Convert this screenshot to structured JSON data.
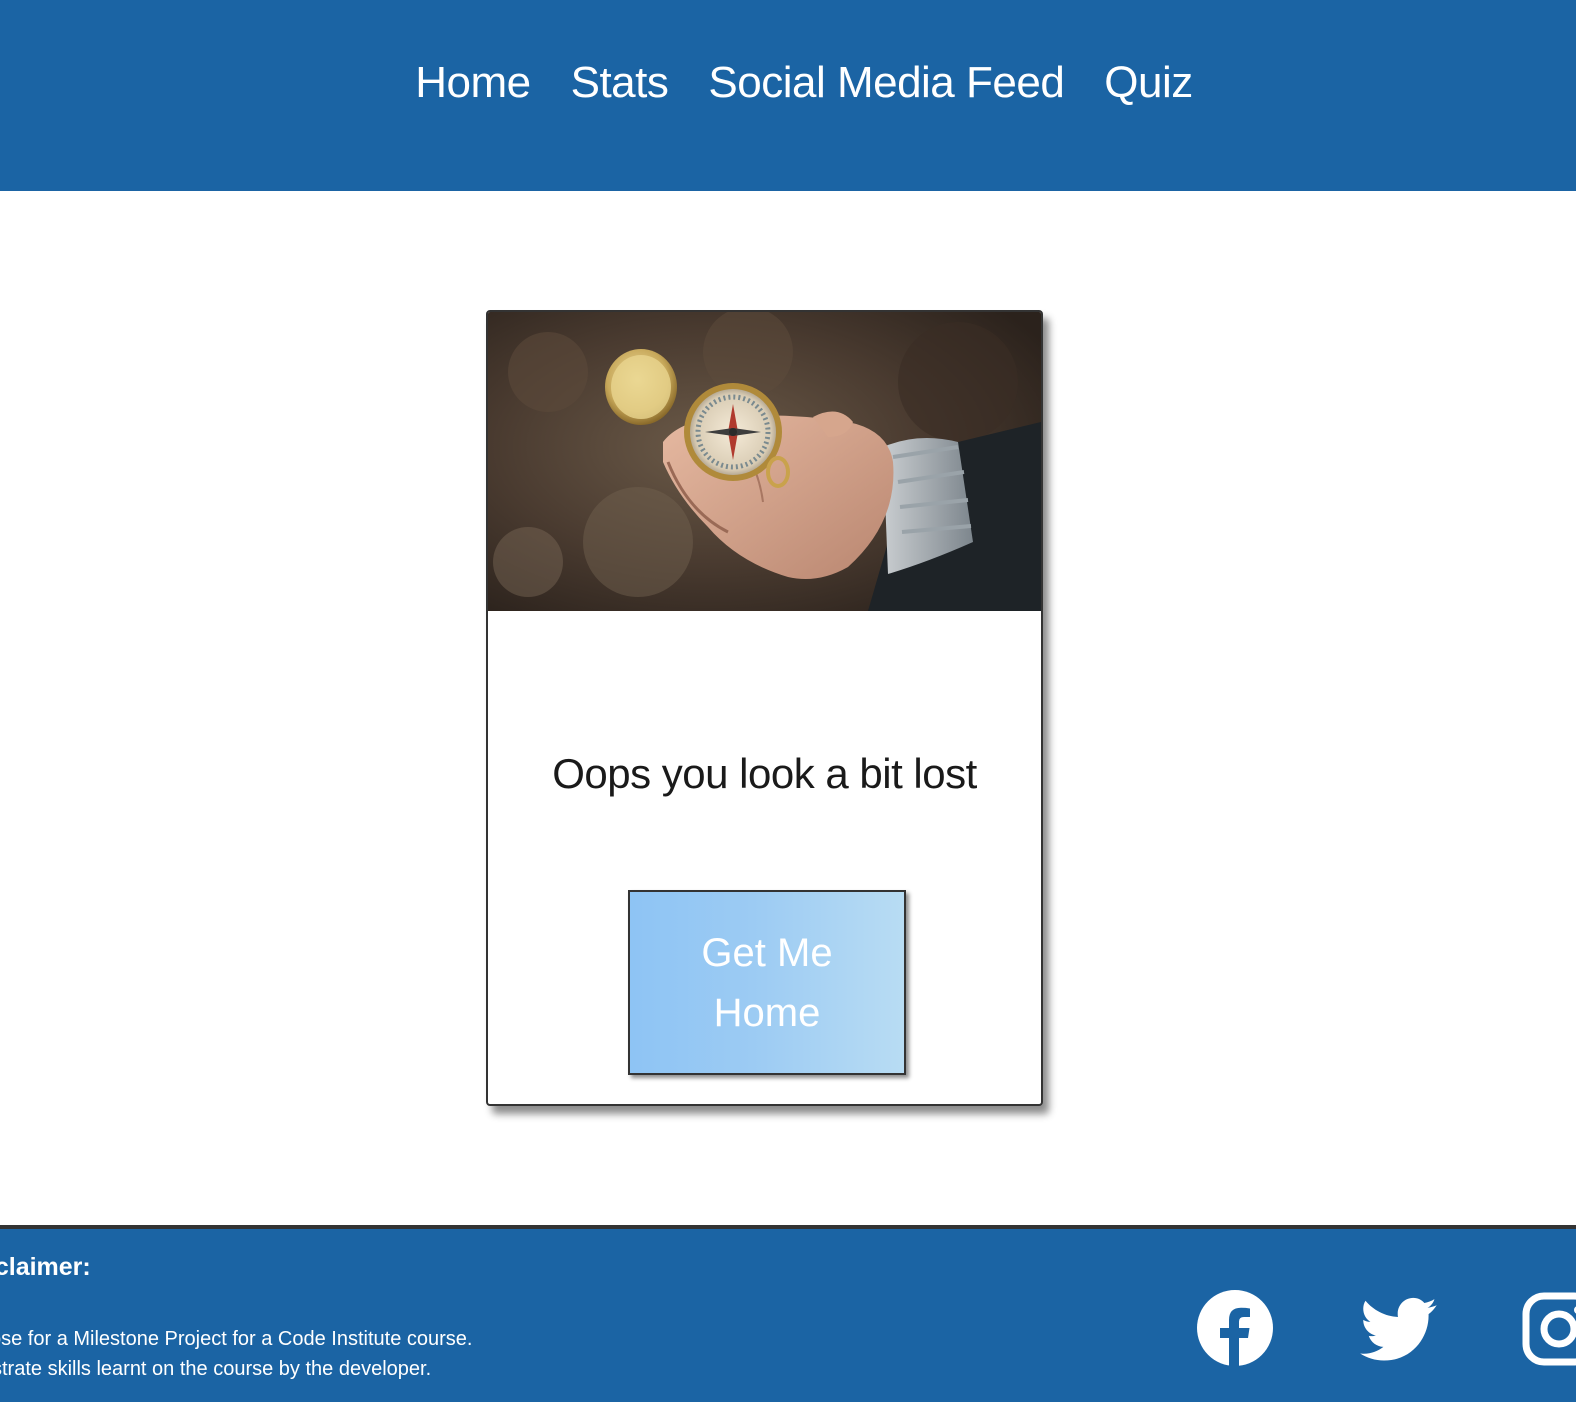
{
  "nav": {
    "items": [
      {
        "label": "Home"
      },
      {
        "label": "Stats"
      },
      {
        "label": "Social Media Feed"
      },
      {
        "label": "Quiz"
      }
    ]
  },
  "card": {
    "image_alt": "Hand holding an open compass",
    "message": "Oops you look a bit lost",
    "button_label": "Get Me Home"
  },
  "footer": {
    "disclaimer_title": "isclaimer:",
    "lines": [
      "ose for a Milestone Project for a Code Institute course.",
      "strate skills learnt on the course by the developer."
    ],
    "social_icons": [
      "facebook-icon",
      "twitter-icon",
      "instagram-icon"
    ]
  },
  "colors": {
    "brand": "#1b64a4",
    "button_gradient_start": "#8ec4f4",
    "button_gradient_end": "#b8dcf3"
  }
}
